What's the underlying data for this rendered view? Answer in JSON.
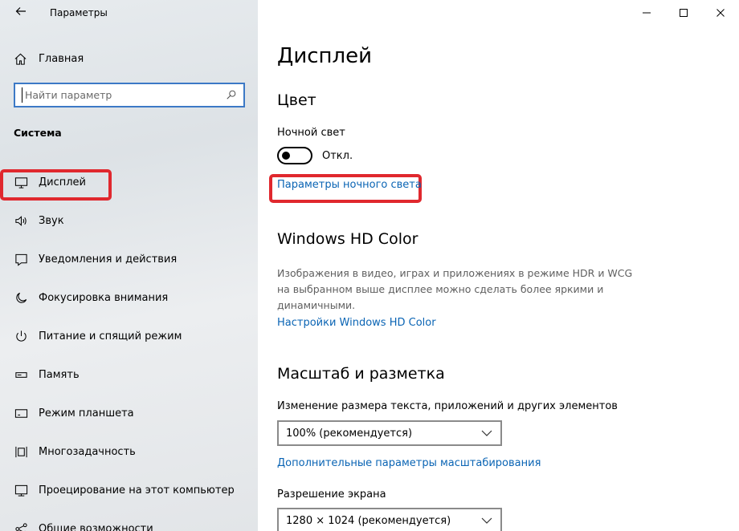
{
  "window": {
    "title": "Параметры",
    "controls": {
      "minimize": "—",
      "maximize": "☐",
      "close": "✕"
    }
  },
  "sidebar": {
    "home_label": "Главная",
    "search": {
      "placeholder": "Найти параметр",
      "value": ""
    },
    "section_title": "Система",
    "items": [
      {
        "label": "Дисплей",
        "icon": "monitor-icon",
        "active": true
      },
      {
        "label": "Звук",
        "icon": "speaker-icon",
        "active": false
      },
      {
        "label": "Уведомления и действия",
        "icon": "notification-icon",
        "active": false
      },
      {
        "label": "Фокусировка внимания",
        "icon": "moon-icon",
        "active": false
      },
      {
        "label": "Питание и спящий режим",
        "icon": "power-icon",
        "active": false
      },
      {
        "label": "Память",
        "icon": "storage-icon",
        "active": false
      },
      {
        "label": "Режим планшета",
        "icon": "tablet-icon",
        "active": false
      },
      {
        "label": "Многозадачность",
        "icon": "multitask-icon",
        "active": false
      },
      {
        "label": "Проецирование на этот компьютер",
        "icon": "projection-icon",
        "active": false
      },
      {
        "label": "Общие возможности",
        "icon": "shared-icon",
        "active": false
      }
    ]
  },
  "main": {
    "page_title": "Дисплей",
    "color": {
      "heading": "Цвет",
      "night_light_label": "Ночной свет",
      "night_light_state": "Откл.",
      "night_light_settings_link": "Параметры ночного света"
    },
    "hd_color": {
      "heading": "Windows HD Color",
      "description": "Изображения в видео, играх и приложениях в режиме HDR и WCG на выбранном выше дисплее можно сделать более яркими и динамичными.",
      "settings_link": "Настройки Windows HD Color"
    },
    "scale": {
      "heading": "Масштаб и разметка",
      "scale_label": "Изменение размера текста, приложений и других элементов",
      "scale_value": "100% (рекомендуется)",
      "advanced_link": "Дополнительные параметры масштабирования",
      "resolution_label": "Разрешение экрана",
      "resolution_value": "1280 × 1024 (рекомендуется)"
    }
  },
  "colors": {
    "accent_link": "#0a64b4",
    "highlight_box": "#e0282e",
    "search_border": "#3c79c6"
  }
}
